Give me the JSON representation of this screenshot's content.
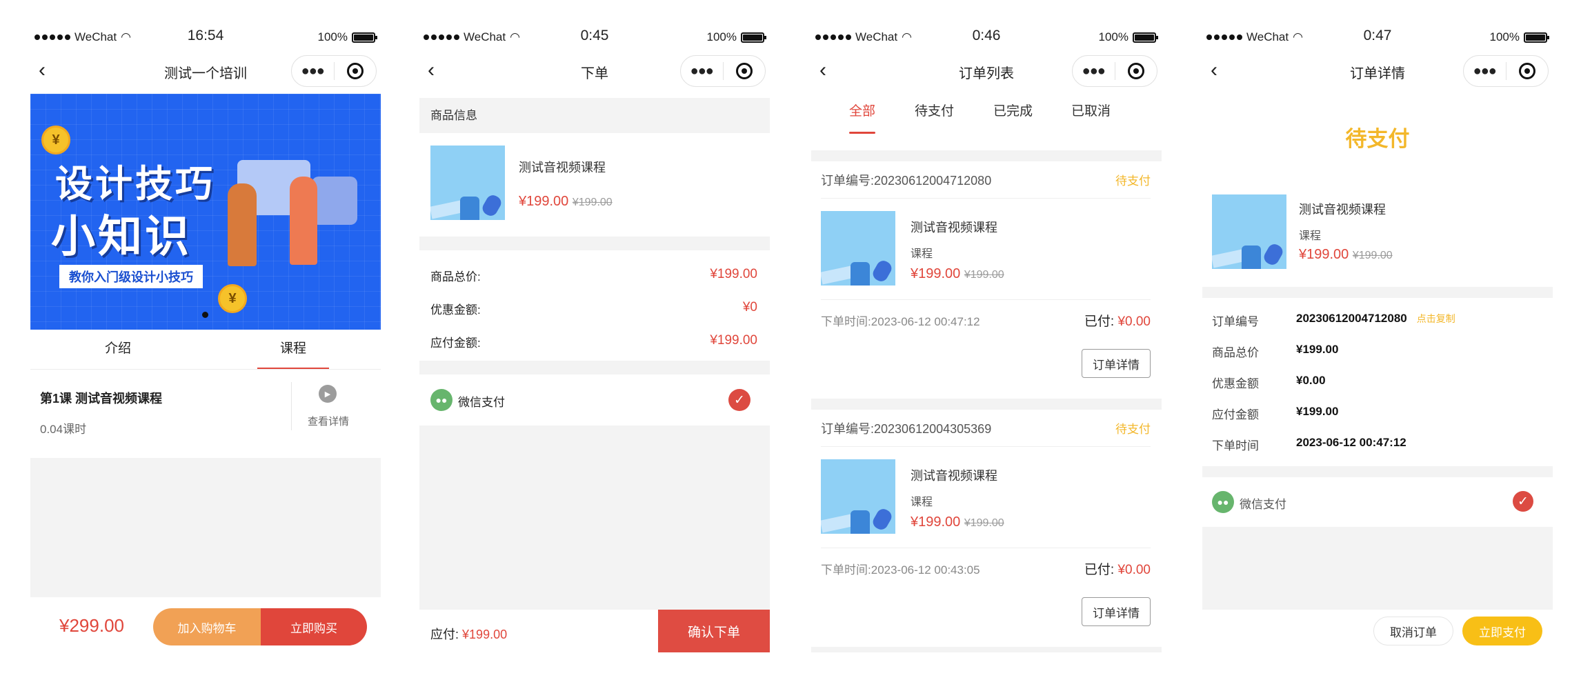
{
  "status_bar": {
    "carrier": "WeChat",
    "battery": "100%",
    "times": [
      "16:54",
      "0:45",
      "0:46",
      "0:47"
    ]
  },
  "icons": {
    "back": "chevron-left-icon",
    "more": "more-dots-icon",
    "record": "target-circle-icon",
    "wifi": "wifi-icon",
    "battery": "battery-icon",
    "play": "play-icon",
    "check": "check-circle-icon",
    "wechat_pay": "wechat-icon"
  },
  "colors": {
    "primary_red": "#e0463b",
    "pending_yellow": "#f3b72a",
    "cart_orange": "#f1a155",
    "banner_blue": "#2264f0",
    "wechat_green": "#67b56d"
  },
  "detail_page": {
    "title": "测试一个培训",
    "banner": {
      "line1": "设计技巧",
      "line2": "小知识",
      "tagline": "教你入门级设计小技巧",
      "coin": "¥"
    },
    "tabs": [
      "介绍",
      "课程"
    ],
    "lesson": {
      "title": "第1课 测试音视频课程",
      "hours": "0.04课时",
      "view": "查看详情"
    },
    "price": "¥299.00",
    "add_cart": "加入购物车",
    "buy_now": "立即购买"
  },
  "checkout_page": {
    "title": "下单",
    "section_goods": "商品信息",
    "item": {
      "name": "测试音视频课程",
      "price": "¥199.00",
      "original": "¥199.00"
    },
    "summary": [
      {
        "label": "商品总价:",
        "value": "¥199.00"
      },
      {
        "label": "优惠金额:",
        "value": "¥0"
      },
      {
        "label": "应付金额:",
        "value": "¥199.00"
      }
    ],
    "payment": "微信支付",
    "footer_label": "应付:",
    "footer_amount": "¥199.00",
    "confirm": "确认下单"
  },
  "order_list_page": {
    "title": "订单列表",
    "tabs": [
      "全部",
      "待支付",
      "已完成",
      "已取消"
    ],
    "orders": [
      {
        "number_label": "订单编号:",
        "number": "20230612004712080",
        "status": "待支付",
        "name": "测试音视频课程",
        "type": "课程",
        "price": "¥199.00",
        "original": "¥199.00",
        "time_label": "下单时间:",
        "time": "2023-06-12 00:47:12",
        "paid_label": "已付:",
        "paid": "¥0.00",
        "detail_btn": "订单详情"
      },
      {
        "number_label": "订单编号:",
        "number": "20230612004305369",
        "status": "待支付",
        "name": "测试音视频课程",
        "type": "课程",
        "price": "¥199.00",
        "original": "¥199.00",
        "time_label": "下单时间:",
        "time": "2023-06-12 00:43:05",
        "paid_label": "已付:",
        "paid": "¥0.00",
        "detail_btn": "订单详情"
      }
    ]
  },
  "order_detail_page": {
    "title": "订单详情",
    "status": "待支付",
    "item": {
      "name": "测试音视频课程",
      "type": "课程",
      "price": "¥199.00",
      "original": "¥199.00"
    },
    "info": [
      {
        "label": "订单编号",
        "value": "20230612004712080"
      },
      {
        "label": "商品总价",
        "value": "¥199.00"
      },
      {
        "label": "优惠金额",
        "value": "¥0.00"
      },
      {
        "label": "应付金额",
        "value": "¥199.00"
      },
      {
        "label": "下单时间",
        "value": "2023-06-12 00:47:12"
      }
    ],
    "copy": "点击复制",
    "payment": "微信支付",
    "cancel": "取消订单",
    "pay_now": "立即支付"
  }
}
